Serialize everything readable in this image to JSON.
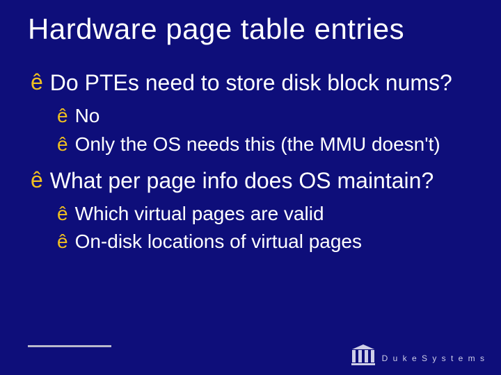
{
  "title": "Hardware page table entries",
  "bullets": [
    {
      "level": 1,
      "marker": "ê",
      "text": "Do PTEs need to store disk block nums?"
    },
    {
      "level": 2,
      "marker": "ê",
      "text": "No"
    },
    {
      "level": 2,
      "marker": "ê",
      "text": "Only the OS needs this (the MMU doesn't)"
    },
    {
      "level": 1,
      "marker": "ê",
      "text": "What per page info does OS maintain?"
    },
    {
      "level": 2,
      "marker": "ê",
      "text": "Which virtual pages are valid"
    },
    {
      "level": 2,
      "marker": "ê",
      "text": "On-disk locations of virtual pages"
    }
  ],
  "logo": {
    "text": "D u k e   S y s t e m s"
  }
}
